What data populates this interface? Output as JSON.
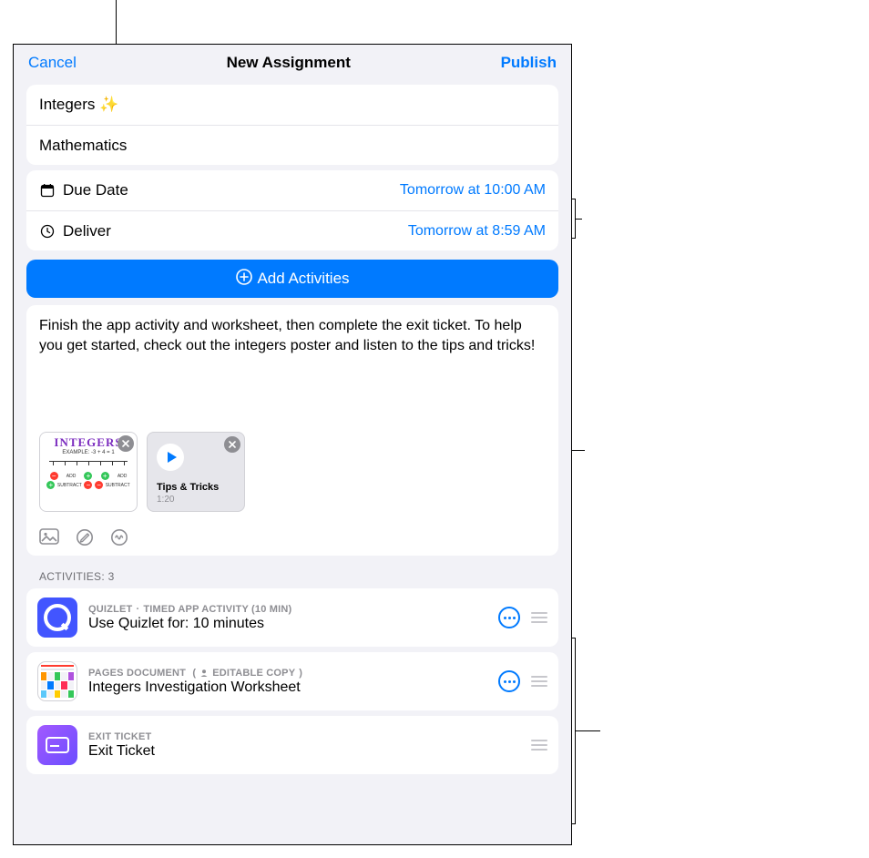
{
  "nav": {
    "cancel": "Cancel",
    "title": "New Assignment",
    "publish": "Publish"
  },
  "fields": {
    "assignmentTitle": "Integers ✨",
    "class": "Mathematics"
  },
  "dueDate": {
    "label": "Due Date",
    "value": "Tomorrow at 10:00 AM"
  },
  "deliver": {
    "label": "Deliver",
    "value": "Tomorrow at 8:59 AM"
  },
  "addActivities": "Add Activities",
  "instructions": "Finish the app activity and worksheet, then complete the exit ticket. To help you get started, check out the integers poster and listen to the tips and tricks!",
  "attachments": {
    "posterTitle": "INTEGERS",
    "posterExample": "EXAMPLE: -3 + 4 = 1",
    "ruleAdd": "ADD",
    "ruleSub": "SUBTRACT",
    "audioName": "Tips & Tricks",
    "audioDuration": "1:20"
  },
  "activitiesHeader": "ACTIVITIES: 3",
  "activities": [
    {
      "meta1": "QUIZLET",
      "meta2": "TIMED APP ACTIVITY (10 MIN)",
      "title": "Use Quizlet for: 10 minutes"
    },
    {
      "meta1": "PAGES DOCUMENT",
      "meta3": "EDITABLE COPY",
      "title": "Integers Investigation Worksheet"
    },
    {
      "meta1": "EXIT TICKET",
      "title": "Exit Ticket"
    }
  ]
}
